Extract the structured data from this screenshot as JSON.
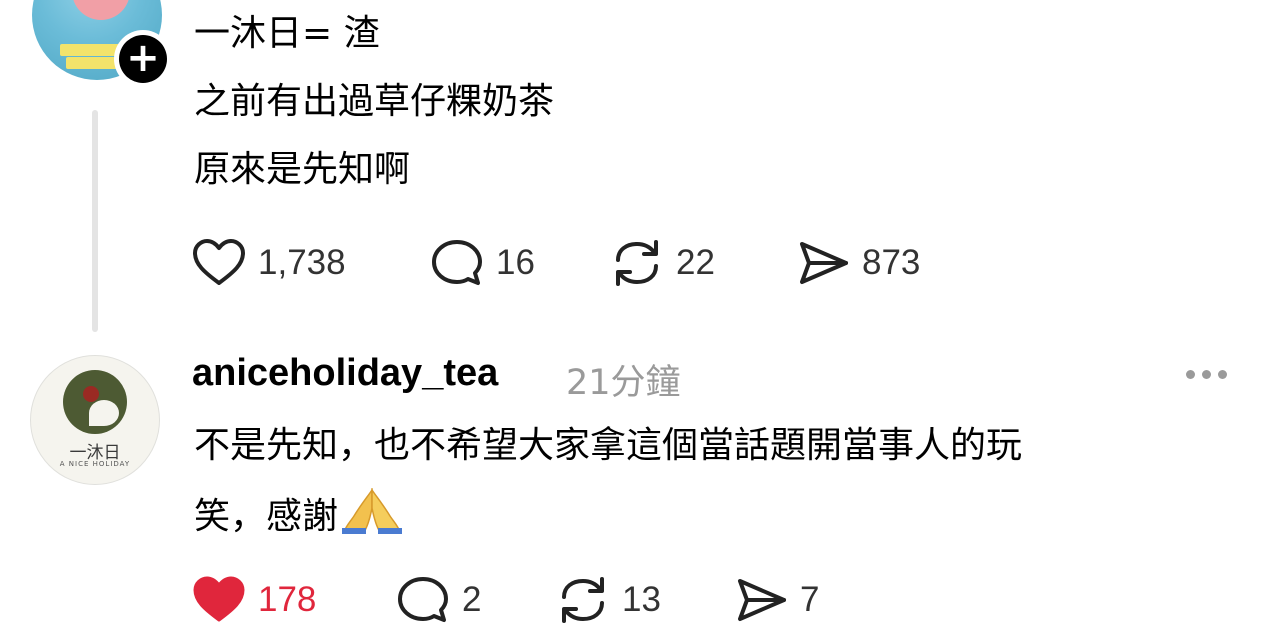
{
  "post": {
    "lines": [
      "一沐日= 渣",
      "之前有出過草仔粿奶茶",
      "原來是先知啊"
    ],
    "likes": "1,738",
    "replies": "16",
    "reposts": "22",
    "shares": "873"
  },
  "reply": {
    "username": "aniceholiday_tea",
    "time": "21分鐘",
    "lines": [
      "不是先知，也不希望大家拿這個當話題開當事人的玩",
      "笑，感謝"
    ],
    "emoji": "🙏",
    "likes": "178",
    "replies": "2",
    "reposts": "13",
    "shares": "7",
    "avatar": {
      "brand_cn": "一沐日",
      "brand_en": "A NICE HOLIDAY"
    }
  },
  "icons": {
    "follow": "plus-icon",
    "like": "heart-icon",
    "reply": "comment-bubble-icon",
    "repost": "repost-icon",
    "share": "send-icon",
    "more": "more-dots-icon"
  },
  "colors": {
    "liked": "#e0263c",
    "text": "#000000",
    "muted": "#9a9a9a",
    "thread_line": "#e4e4e4"
  }
}
